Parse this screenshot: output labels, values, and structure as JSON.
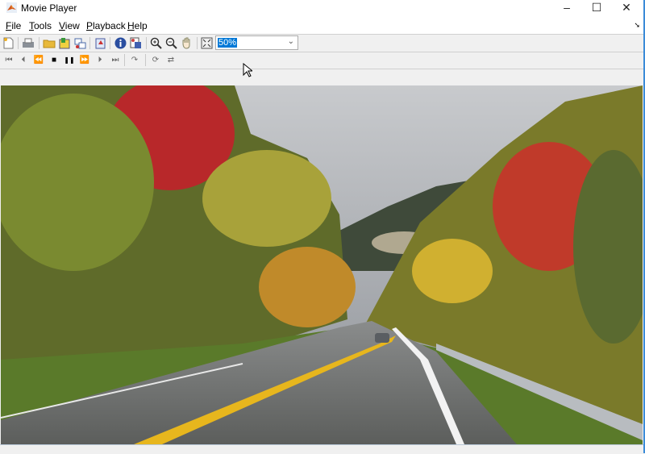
{
  "window": {
    "title": "Movie Player",
    "minimize": "–",
    "maximize": "☐",
    "close": "✕"
  },
  "menu": [
    {
      "label": "File",
      "accel": "F",
      "rest": "ile"
    },
    {
      "label": "Tools",
      "accel": "T",
      "rest": "ools"
    },
    {
      "label": "View",
      "accel": "V",
      "rest": "iew"
    },
    {
      "label": "Playback",
      "accel": "P",
      "rest": "layback"
    },
    {
      "label": "Help",
      "accel": "H",
      "rest": "elp"
    }
  ],
  "toolbar": {
    "zoom_value": "50%",
    "zoom_chevron": "⌄"
  },
  "playback_icons": [
    "⏮",
    "⏴",
    "⏪",
    "■",
    "❚❚",
    "⏩",
    "⏵",
    "⏭",
    "↷",
    "⟳",
    "⇄"
  ],
  "video": {
    "description_colors": {
      "sky": "#a9acb1",
      "foliage_red": "#c0302a",
      "foliage_yellow": "#c8a22a",
      "road": "#6e6f6e",
      "line_yellow": "#e7b61d"
    }
  }
}
